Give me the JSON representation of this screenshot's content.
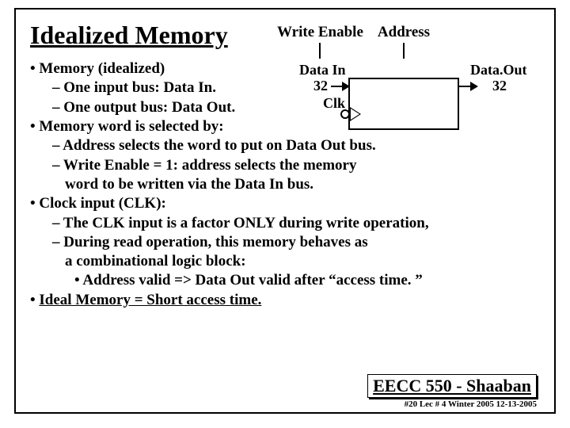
{
  "title": "Idealized Memory",
  "signals": {
    "write_enable": "Write Enable",
    "address": "Address"
  },
  "diagram": {
    "data_in": "Data In",
    "width_in": "32",
    "clk": "Clk",
    "data_out": "Data.Out",
    "width_out": "32"
  },
  "bullets": {
    "b1": "Memory (idealized)",
    "b1s1": "One input bus:  Data In.",
    "b1s2": "One output bus:  Data Out.",
    "b2": "Memory word is selected by:",
    "b2s1": "Address selects the word to put on Data Out bus.",
    "b2s2a": "Write Enable = 1:  address selects the memory",
    "b2s2b": "word to be written via the  Data In bus.",
    "b3": "Clock input (CLK):",
    "b3s1": "The CLK input is a factor ONLY during write operation,",
    "b3s2a": "During read operation, this memory behaves  as",
    "b3s2b": "a combinational logic block:",
    "b3s2sub": "Address valid  => Data Out valid after “access time. ”",
    "b4": "Ideal Memory = Short access time."
  },
  "footer": {
    "course": "EECC 550 - Shaaban",
    "meta": "#20   Lec # 4   Winter 2005   12-13-2005"
  }
}
